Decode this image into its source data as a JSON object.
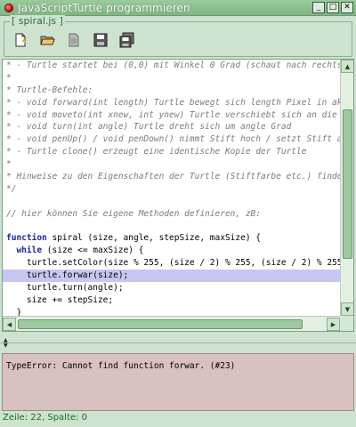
{
  "window": {
    "title": "JavaScriptTurtle programmieren",
    "buttons": [
      "_",
      "□",
      "✕"
    ]
  },
  "panel": {
    "label": "[ spiral.js ]",
    "toolbar": [
      {
        "icon": "new-file-icon"
      },
      {
        "icon": "open-folder-icon"
      },
      {
        "icon": "document-icon"
      },
      {
        "icon": "save-icon"
      },
      {
        "icon": "save-all-icon"
      }
    ]
  },
  "editor": {
    "lines": [
      {
        "text": "* - Turtle startet bei (0,0) mit Winkel 0 Grad (schaut nach rechts)",
        "style": "comment"
      },
      {
        "text": "*",
        "style": "comment"
      },
      {
        "text": "* Turtle-Befehle:",
        "style": "comment"
      },
      {
        "text": "* - void forward(int length) Turtle bewegt sich length Pixel in ak",
        "style": "comment"
      },
      {
        "text": "* - void moveto(int xnew, int ynew) Turtle verschiebt sich an die",
        "style": "comment"
      },
      {
        "text": "* - void turn(int angle) Turtle dreht sich um angle Grad",
        "style": "comment"
      },
      {
        "text": "* - void penUp() / void penDown() nimmt Stift hoch / setzt Stift a",
        "style": "comment"
      },
      {
        "text": "* - Turtle clone() erzeugt eine identische Kopie der Turtle",
        "style": "comment"
      },
      {
        "text": "*",
        "style": "comment"
      },
      {
        "text": "* Hinweise zu den Eigenschaften der Turtle (Stiftfarbe etc.) finde",
        "style": "comment"
      },
      {
        "text": "*/",
        "style": "comment"
      },
      {
        "text": "",
        "style": "plain"
      },
      {
        "text": "// hier können Sie eigene Methoden definieren, zB:",
        "style": "comment"
      },
      {
        "text": "",
        "style": "plain"
      },
      {
        "kw": "function",
        "text": " spiral (size, angle, stepSize, maxSize) {",
        "style": "plain"
      },
      {
        "indent": "  ",
        "kw": "while",
        "text": " (size <= maxSize) {",
        "style": "plain"
      },
      {
        "text": "    turtle.setColor(size % 255, (size / 2) % 255, (size / 2) % 255)",
        "style": "plain"
      },
      {
        "text": "    turtle.forwar(size);",
        "style": "plain",
        "highlight": true
      },
      {
        "text": "    turtle.turn(angle);",
        "style": "plain"
      },
      {
        "text": "    size += stepSize;",
        "style": "plain"
      },
      {
        "text": "  }",
        "style": "plain"
      },
      {
        "text": "}",
        "style": "plain"
      }
    ]
  },
  "output": {
    "text": "TypeError: Cannot find function forwar. (#23)"
  },
  "status": {
    "text": "Zeile: 22, Spalte: 0"
  },
  "colors": {
    "background": "#cde3cf",
    "highlight": "#c5c7f2",
    "output_bg": "#d8c1c0",
    "keyword": "#1d24a8"
  }
}
